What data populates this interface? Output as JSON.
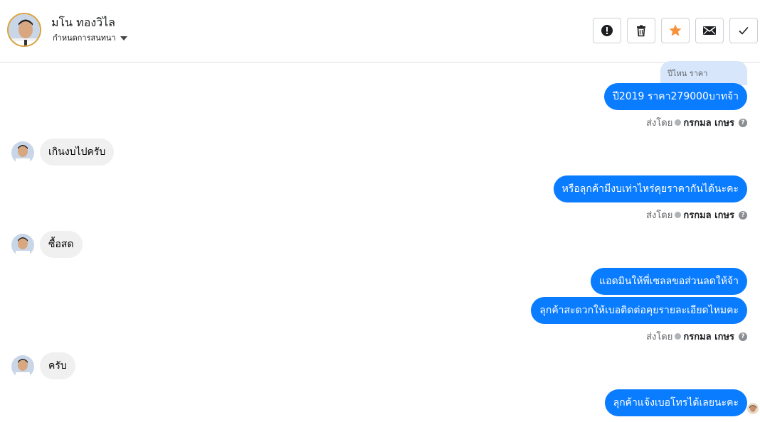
{
  "header": {
    "contact_name": "มโน ทองวิไล",
    "conversation_settings": "กำหนดการสนทนา",
    "actions": [
      {
        "name": "mark-spam",
        "icon": "exclamation-icon"
      },
      {
        "name": "delete",
        "icon": "trash-icon"
      },
      {
        "name": "star",
        "icon": "star-icon"
      },
      {
        "name": "mark-unread",
        "icon": "envelope-icon"
      },
      {
        "name": "mark-done",
        "icon": "check-icon"
      }
    ]
  },
  "messages": {
    "reply_preview": "ปีไหน ราคา",
    "m1": "ปี2019 ราคา279000บาทจ้า",
    "m2": "เกินงบไปครับ",
    "m3": "หรือลุกค้ามีงบเท่าไหร่คุยราคากันได้นะคะ",
    "m4": "ซื้อสด",
    "m5": "แอดมินให้พี่เซลลขอส่วนลดให้จ้า",
    "m6": "ลุกค้าสะดวกให้เบอติดต่อคุยรายละเอียดไหมคะ",
    "m7": "ครับ",
    "m8": "ลุกค้าแจ้งเบอโทรได้เลยนะคะ"
  },
  "sent_by": {
    "label": "ส่งโดย",
    "agent": "กรกมล เกษร",
    "help": "?"
  },
  "colors": {
    "outgoing": "#0a7cff",
    "incoming": "#f0f0f0",
    "star": "#f7923a"
  }
}
